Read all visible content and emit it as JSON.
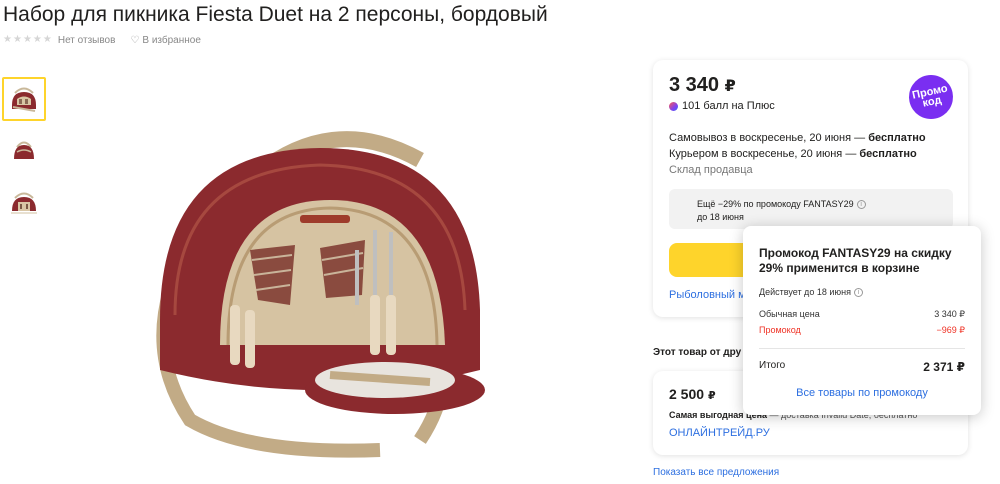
{
  "product": {
    "title": "Набор для пикника Fiesta Duet на 2 персоны, бордовый",
    "rating_stars": 5,
    "reviews_text": "Нет отзывов",
    "favorite_text": "В избранное"
  },
  "gallery": {
    "thumbnails": [
      "thumbnail-1",
      "thumbnail-2",
      "thumbnail-3"
    ],
    "active_index": 0
  },
  "buybox": {
    "price": "3 340",
    "currency": "₽",
    "plus_points": "101 балл на Плюс",
    "promo_badge": "Промо код",
    "delivery": {
      "pickup_prefix": "Самовывоз в воскресенье, 20 июня — ",
      "pickup_free": "бесплатно",
      "courier_prefix": "Курьером в воскресенье, 20 июня — ",
      "courier_free": "бесплатно",
      "warehouse": "Склад продавца"
    },
    "promo_hint_line1": "Ещё −29% по промокоду FANTASY29",
    "promo_hint_line2": "до 18 июня",
    "seller_link": "Рыболовный м"
  },
  "popover": {
    "title": "Промокод FANTASY29 на скидку 29% применится в корзине",
    "valid_until": "Действует до 18 июня",
    "regular_price_label": "Обычная цена",
    "regular_price_value": "3 340 ₽",
    "promo_label": "Промокод",
    "promo_value": "−969 ₽",
    "total_label": "Итого",
    "total_value": "2 371 ₽",
    "all_products_link": "Все товары по промокоду"
  },
  "other_offers": {
    "heading": "Этот товар от дру",
    "offer_price": "2 500",
    "offer_currency": "₽",
    "offer_delivery_bold": "Самая выгодная цена",
    "offer_delivery_rest": " — доставка Invalid Date, бесплатно",
    "offer_seller": "ОНЛАЙНТРЕЙД.РУ",
    "show_all": "Показать все предложения"
  },
  "colors": {
    "accent_yellow": "#fed42b",
    "link_blue": "#2d6fe0",
    "promo_purple": "#7a2ef1",
    "discount_red": "#ef3124",
    "bag_burgundy": "#8b2a2e"
  }
}
